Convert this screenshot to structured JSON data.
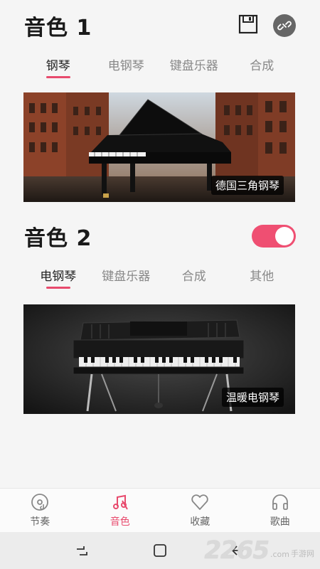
{
  "section1": {
    "title": "音色 1",
    "tabs": [
      "钢琴",
      "电钢琴",
      "键盘乐器",
      "合成"
    ],
    "active_tab": 0,
    "banner_label": "德国三角钢琴"
  },
  "section2": {
    "title": "音色 2",
    "toggle_on": true,
    "tabs": [
      "电钢琴",
      "键盘乐器",
      "合成",
      "其他"
    ],
    "active_tab": 0,
    "banner_label": "温暖电钢琴"
  },
  "bottom_nav": [
    {
      "label": "节奏",
      "icon": "rhythm-disc-icon"
    },
    {
      "label": "音色",
      "icon": "music-note-icon"
    },
    {
      "label": "收藏",
      "icon": "heart-icon"
    },
    {
      "label": "歌曲",
      "icon": "headphones-icon"
    }
  ],
  "bottom_nav_active": 1,
  "system_nav": [
    "recent-apps-icon",
    "home-icon",
    "back-icon"
  ],
  "watermark": {
    "number": "2265",
    "suffix": ".com",
    "sub": "手游网"
  },
  "colors": {
    "accent": "#e84a6d",
    "toggle": "#ef4f72",
    "background": "#f5f5f5"
  }
}
